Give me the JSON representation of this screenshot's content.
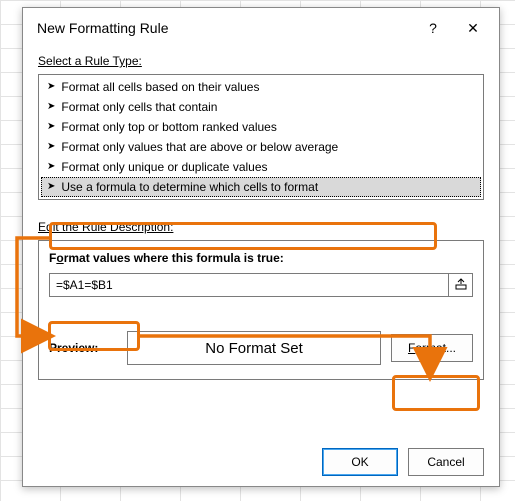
{
  "dialog": {
    "title": "New Formatting Rule",
    "help_icon": "?",
    "close_icon": "✕",
    "select_rule_label": "Select a Rule Type:",
    "edit_rule_label": "Edit the Rule Description:",
    "rule_types": [
      "Format all cells based on their values",
      "Format only cells that contain",
      "Format only top or bottom ranked values",
      "Format only values that are above or below average",
      "Format only unique or duplicate values",
      "Use a formula to determine which cells to format"
    ],
    "formula_heading": "Format values where this formula is true:",
    "formula_value": "=$A1=$B1",
    "preview_label": "Preview:",
    "preview_text": "No Format Set",
    "format_button": "Format...",
    "ok_button": "OK",
    "cancel_button": "Cancel"
  }
}
